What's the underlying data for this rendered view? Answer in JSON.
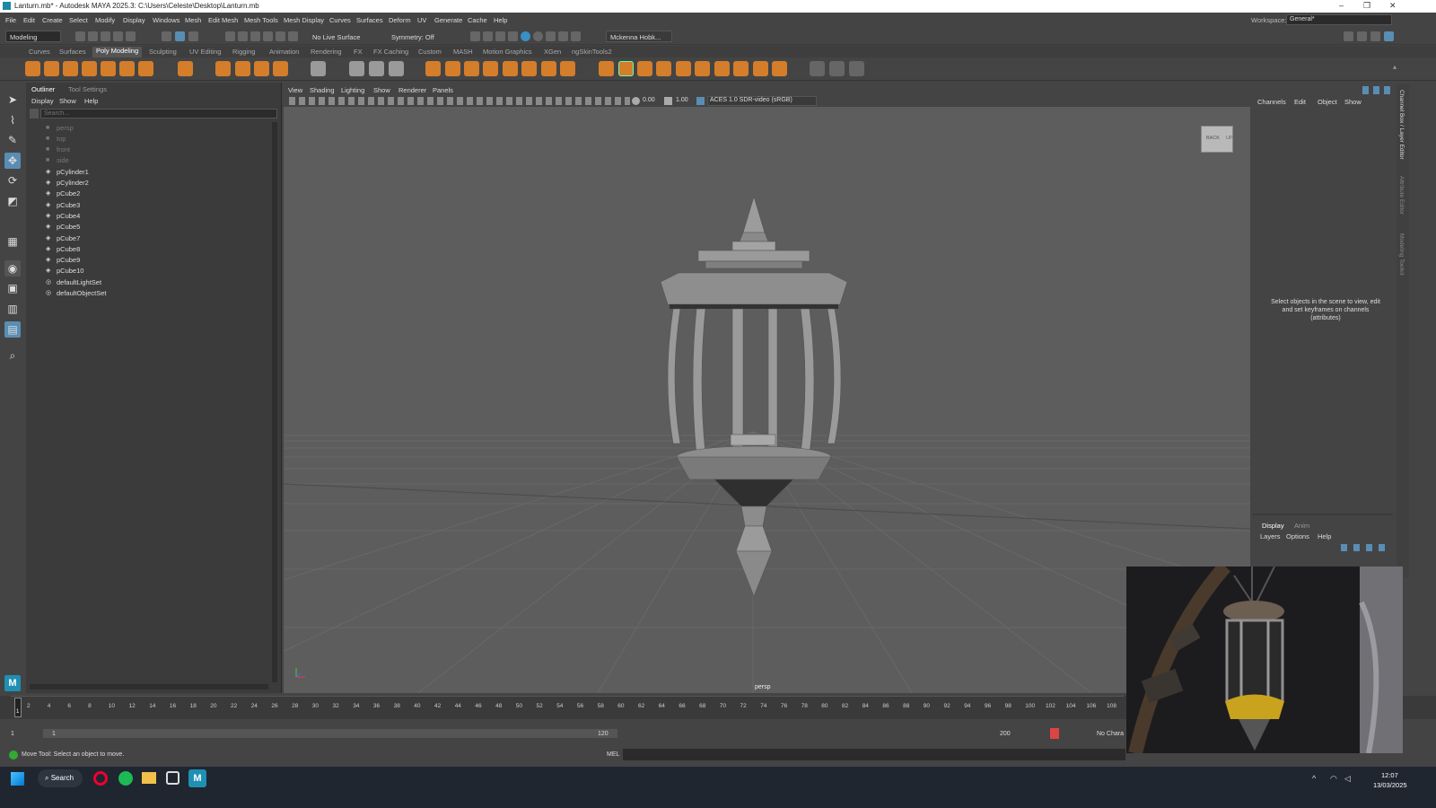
{
  "window": {
    "title": "Lanturn.mb* - Autodesk MAYA 2025.3: C:\\Users\\Celeste\\Desktop\\Lanturn.mb",
    "minimize": "–",
    "maximize": "❐",
    "close": "✕"
  },
  "menubar": [
    "File",
    "Edit",
    "Create",
    "Select",
    "Modify",
    "Display",
    "Windows",
    "Mesh",
    "Edit Mesh",
    "Mesh Tools",
    "Mesh Display",
    "Curves",
    "Surfaces",
    "Deform",
    "UV",
    "Generate",
    "Cache",
    "Help"
  ],
  "workspace": {
    "label": "Workspace:",
    "value": "General*"
  },
  "statusline": {
    "mode": "Modeling",
    "live_surface": "No Live Surface",
    "symmetry": "Symmetry: Off",
    "user": "Mckenna Hobk..."
  },
  "shelf_tabs": [
    "Curves",
    "Surfaces",
    "Poly Modeling",
    "Sculpting",
    "UV Editing",
    "Rigging",
    "Animation",
    "Rendering",
    "FX",
    "FX Caching",
    "Custom",
    "MASH",
    "Motion Graphics",
    "XGen",
    "ngSkinTools2"
  ],
  "shelf_active": "Poly Modeling",
  "outliner": {
    "tabs": [
      "Outliner",
      "Tool Settings"
    ],
    "menu": [
      "Display",
      "Show",
      "Help"
    ],
    "search_placeholder": "Search...",
    "items": [
      {
        "label": "persp",
        "dim": true,
        "icon": "camera-icon"
      },
      {
        "label": "top",
        "dim": true,
        "icon": "camera-icon"
      },
      {
        "label": "front",
        "dim": true,
        "icon": "camera-icon"
      },
      {
        "label": "side",
        "dim": true,
        "icon": "camera-icon"
      },
      {
        "label": "pCylinder1",
        "dim": false,
        "icon": "mesh-icon"
      },
      {
        "label": "pCylinder2",
        "dim": false,
        "icon": "mesh-icon"
      },
      {
        "label": "pCube2",
        "dim": false,
        "icon": "mesh-icon"
      },
      {
        "label": "pCube3",
        "dim": false,
        "icon": "mesh-icon"
      },
      {
        "label": "pCube4",
        "dim": false,
        "icon": "mesh-icon"
      },
      {
        "label": "pCube5",
        "dim": false,
        "icon": "mesh-icon"
      },
      {
        "label": "pCube7",
        "dim": false,
        "icon": "mesh-icon"
      },
      {
        "label": "pCube8",
        "dim": false,
        "icon": "mesh-icon"
      },
      {
        "label": "pCube9",
        "dim": false,
        "icon": "mesh-icon"
      },
      {
        "label": "pCube10",
        "dim": false,
        "icon": "mesh-icon"
      },
      {
        "label": "defaultLightSet",
        "dim": false,
        "icon": "set-icon"
      },
      {
        "label": "defaultObjectSet",
        "dim": false,
        "icon": "set-icon"
      }
    ]
  },
  "viewport": {
    "menu": [
      "View",
      "Shading",
      "Lighting",
      "Show",
      "Renderer",
      "Panels"
    ],
    "field_a": "0.00",
    "field_b": "1.00",
    "colorspace": "ACES 1.0 SDR-video (sRGB)",
    "camera_label": "persp",
    "viewcube_back": "BACK",
    "viewcube_up": "UP"
  },
  "channel_box": {
    "menu": [
      "Channels",
      "Edit",
      "Object",
      "Show"
    ],
    "hint": "Select objects in the scene to view, edit and set keyframes on channels (attributes)",
    "side_tabs": [
      "Channel Box / Layer Editor",
      "Attribute Editor",
      "Modeling Toolkit"
    ]
  },
  "layer_editor": {
    "tabs": [
      "Display",
      "Anim"
    ],
    "menu": [
      "Layers",
      "Options",
      "Help"
    ]
  },
  "timeline": {
    "ticks": [
      "2",
      "4",
      "6",
      "8",
      "10",
      "12",
      "14",
      "16",
      "18",
      "20",
      "22",
      "24",
      "26",
      "28",
      "30",
      "32",
      "34",
      "36",
      "38",
      "40",
      "42",
      "44",
      "46",
      "48",
      "50",
      "52",
      "54",
      "56",
      "58",
      "60",
      "62",
      "64",
      "66",
      "68",
      "70",
      "72",
      "74",
      "76",
      "78",
      "80",
      "82",
      "84",
      "86",
      "88",
      "90",
      "92",
      "94",
      "96",
      "98",
      "100",
      "102",
      "104",
      "106",
      "108"
    ],
    "current_marker": "1"
  },
  "range": {
    "start": "1",
    "inner_start": "1",
    "inner_end": "120",
    "end": "200",
    "character": "No Chara"
  },
  "helpline": {
    "text": "Move Tool: Select an object to move.",
    "mel": "MEL"
  },
  "taskbar": {
    "search": "Search",
    "time": "12:07",
    "date": "13/03/2025"
  }
}
